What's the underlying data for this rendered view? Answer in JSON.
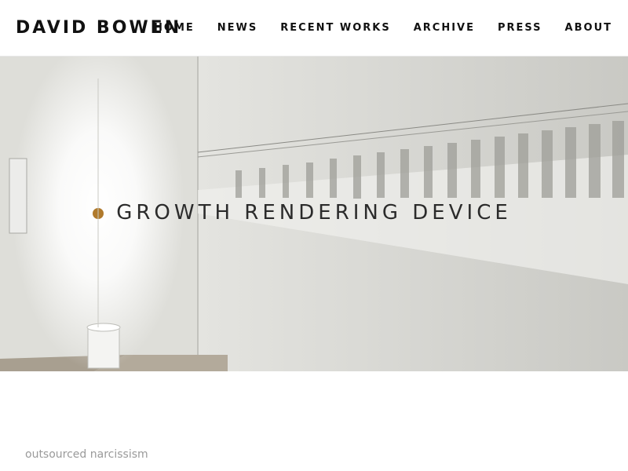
{
  "site": {
    "logo": "DAVID BOWEN"
  },
  "nav": {
    "items": [
      {
        "label": "HOME"
      },
      {
        "label": "NEWS"
      },
      {
        "label": "RECENT WORKS"
      },
      {
        "label": "ARCHIVE"
      },
      {
        "label": "PRESS"
      },
      {
        "label": "ABOUT"
      }
    ]
  },
  "hero": {
    "title": "GROWTH RENDERING DEVICE"
  },
  "content": {
    "subtitle": "outsourced narcissism"
  },
  "colors": {
    "text": "#111111",
    "hero_title": "#2b2b2b",
    "subtitle": "#9a9a9a"
  }
}
